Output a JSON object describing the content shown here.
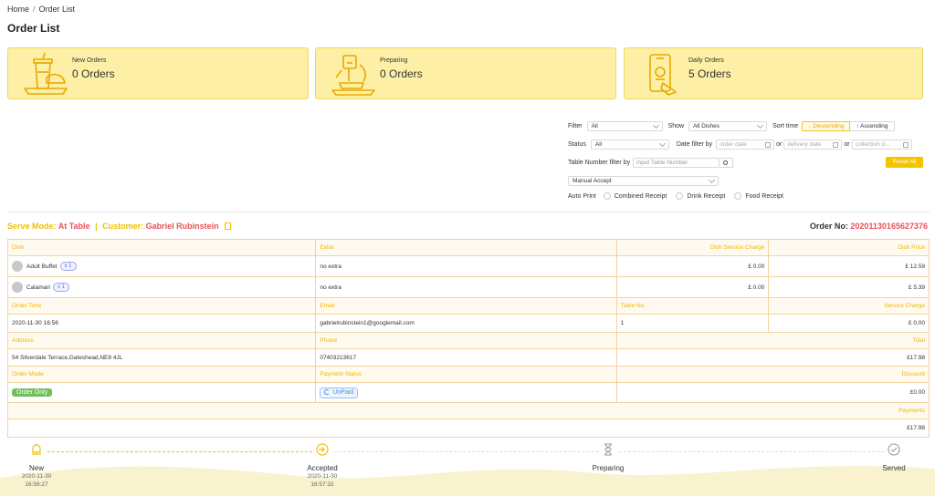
{
  "breadcrumb": {
    "home": "Home",
    "separator": "/",
    "current": "Order List"
  },
  "page_title": "Order List",
  "stats": [
    {
      "label": "New Orders",
      "value": "0 Orders",
      "icon": "takeaway-cup-icon"
    },
    {
      "label": "Preparing",
      "value": "0 Orders",
      "icon": "chef-cooking-icon"
    },
    {
      "label": "Daily Orders",
      "value": "5 Orders",
      "icon": "phone-order-icon"
    }
  ],
  "filters": {
    "filter_label": "Filter",
    "filter_value": "All",
    "show_label": "Show",
    "show_value": "All Dishes",
    "sort_label": "Sort time",
    "sort_desc": "↓ Descending",
    "sort_asc": "↑ Ascending",
    "status_label": "Status",
    "status_value": "All",
    "date_filter_label": "Date filter by",
    "order_date_placeholder": "order date",
    "or1": "or",
    "delivery_date_placeholder": "delivery date",
    "or2": "or",
    "collection_date_placeholder": "collection d...",
    "table_number_label": "Table Number filter by",
    "table_number_placeholder": "input Table Number",
    "reset_label": "Reset All",
    "accept_mode_value": "Manual Accept",
    "auto_print_label": "Auto Print",
    "print_options": [
      "Combined Receipt",
      "Drink Receipt",
      "Food Receipt"
    ]
  },
  "order": {
    "serve_mode_label": "Serve Mode:",
    "serve_mode_value": "At Table",
    "bar": "|",
    "customer_label": "Customer:",
    "customer_value": "Gabriel Rubinstein",
    "order_no_label": "Order No:",
    "order_no_value": "20201130165627376",
    "headers": {
      "dish": "Dish",
      "extra": "Extra",
      "dish_service_charge": "Dish Service Charge",
      "dish_price": "Dish Price"
    },
    "items": [
      {
        "name": "Adult Buffet",
        "qty": "x 1",
        "extra": "no extra",
        "service_charge": "£ 0.00",
        "price": "£ 12.59"
      },
      {
        "name": "Calamari",
        "qty": "x 1",
        "extra": "no extra",
        "service_charge": "£ 0.00",
        "price": "£ 5.39"
      }
    ],
    "info_headers_1": {
      "order_time": "Order Time",
      "email": "Email",
      "table_no": "Table No.",
      "service_charge": "Service Charge"
    },
    "info_values_1": {
      "order_time": "2020-11-30 16:56",
      "email": "gabrielrubinstein1@googlemail.com",
      "table_no": "1",
      "service_charge": "£ 0.00"
    },
    "info_headers_2": {
      "address": "Address",
      "phone": "Phone",
      "total": "Total"
    },
    "info_values_2": {
      "address": "54 Silverdale Terrace,Gateshead,NE8 4JL",
      "phone": "07403213617",
      "total": "£17.98"
    },
    "info_headers_3": {
      "order_mode": "Order Mode",
      "payment_status": "Payment Status",
      "discount": "Discount"
    },
    "info_values_3": {
      "order_mode": "Order Only",
      "payment_status": "UnPaid",
      "discount": "£0.00"
    },
    "payments_label": "Payments",
    "payments_value": "£17.98"
  },
  "steps": [
    {
      "label": "New",
      "date": "2020-11-30",
      "time": "16:56:27",
      "icon": "bell-icon"
    },
    {
      "label": "Accepted",
      "date": "2020-11-30",
      "time": "16:57:32",
      "icon": "login-arrow-icon"
    },
    {
      "label": "Preparing",
      "date": "",
      "time": "",
      "icon": "hourglass-icon"
    },
    {
      "label": "Served",
      "date": "",
      "time": "",
      "icon": "check-circle-icon"
    }
  ],
  "colors": {
    "accent": "#f0c000",
    "card_bg": "#fdf0a6",
    "red": "#e8505b",
    "green": "#6dc05a",
    "blue": "#4a8ee0"
  }
}
